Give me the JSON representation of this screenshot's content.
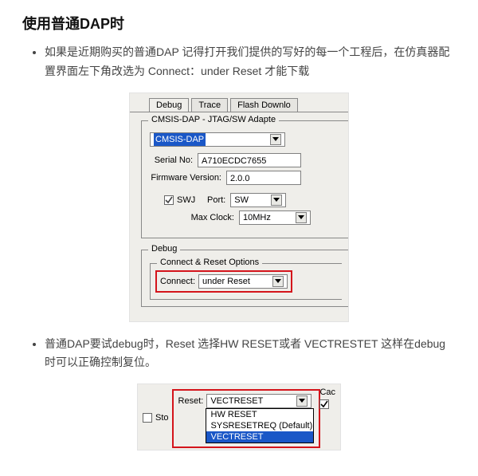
{
  "heading": "使用普通DAP时",
  "bullets": {
    "b1": "如果是近期购买的普通DAP 记得打开我们提供的写好的每一个工程后，在仿真器配置界面左下角改选为 Connect：under Reset 才能下载",
    "b2": "普通DAP要试debug时，Reset 选择HW RESET或者 VECTRESTET 这样在debug时可以正确控制复位。"
  },
  "shot1": {
    "tabs": {
      "debug": "Debug",
      "trace": "Trace",
      "flash": "Flash Downlo"
    },
    "adapter": {
      "group": "CMSIS-DAP - JTAG/SW Adapte",
      "device": "CMSIS-DAP",
      "serialLabel": "Serial No:",
      "serial": "A710ECDC7655",
      "fwLabel": "Firmware Version:",
      "fw": "2.0.0",
      "swjLabel": "SWJ",
      "portLabel": "Port:",
      "port": "SW",
      "clockLabel": "Max Clock:",
      "clock": "10MHz"
    },
    "debug": {
      "group": "Debug",
      "sub": "Connect & Reset Options",
      "connectLabel": "Connect:",
      "connect": "under Reset"
    }
  },
  "shot2": {
    "cacLabel": "Cac",
    "cacChecked": true,
    "stoLabel": "Sto",
    "resetLabel": "Reset:",
    "resetValue": "VECTRESET",
    "options": {
      "o1": "HW RESET",
      "o2": "SYSRESETREQ (Default)",
      "o3": "VECTRESET"
    }
  }
}
